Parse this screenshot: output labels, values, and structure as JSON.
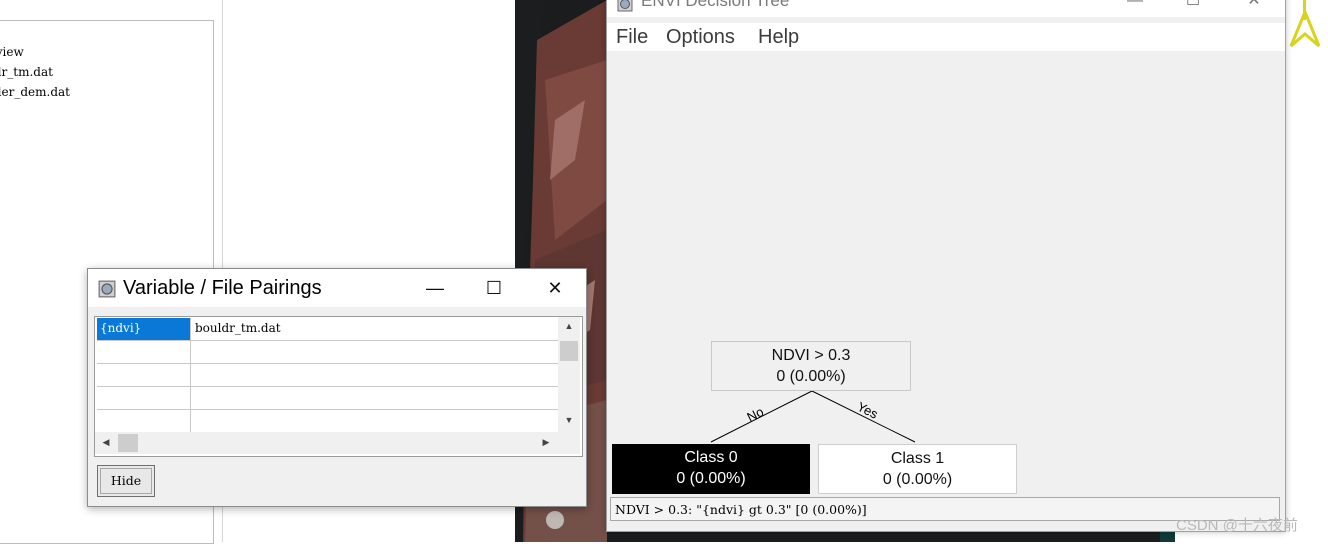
{
  "file_list": {
    "items": [
      "rview",
      "ldr_tm.dat",
      "lder_dem.dat"
    ]
  },
  "decision_tree_window": {
    "title": "ENVI Decision Tree",
    "controls": {
      "minimize": "—",
      "maximize": "☐",
      "close": "✕"
    },
    "menu": [
      "File",
      "Options",
      "Help"
    ],
    "root_node": {
      "condition": "NDVI > 0.3",
      "stats": "0 (0.00%)"
    },
    "branches": {
      "no_label": "No",
      "yes_label": "Yes"
    },
    "class_nodes": [
      {
        "label": "Class 0",
        "stats": "0 (0.00%)",
        "fill": "#000000"
      },
      {
        "label": "Class 1",
        "stats": "0 (0.00%)",
        "fill": "#ffffff"
      }
    ],
    "status": "NDVI > 0.3: \"{ndvi} gt 0.3\" [0 (0.00%)]"
  },
  "variable_dialog": {
    "title": "Variable / File Pairings",
    "controls": {
      "minimize": "—",
      "maximize": "☐",
      "close": "✕"
    },
    "rows": [
      {
        "variable": "{ndvi}",
        "file": "bouldr_tm.dat",
        "selected": true
      },
      {
        "variable": "",
        "file": "",
        "selected": false
      },
      {
        "variable": "",
        "file": "",
        "selected": false
      },
      {
        "variable": "",
        "file": "",
        "selected": false
      },
      {
        "variable": "",
        "file": "",
        "selected": false
      }
    ],
    "scroll_up": "▲",
    "scroll_down": "▼",
    "scroll_left": "◀",
    "scroll_right": "▶",
    "hide_label": "Hide"
  },
  "watermark": "CSDN @十六夜前",
  "colors": {
    "selection": "#0a78d7",
    "window_bg": "#f0f0f0",
    "north_arrow": "#e6e22b"
  }
}
